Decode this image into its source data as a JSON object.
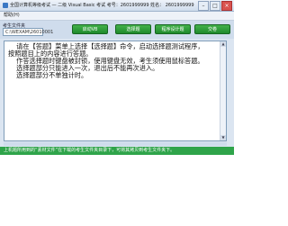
{
  "window": {
    "title": "全国计算机等级考试 — 二级 Visual Basic 考试   考号：2601999999   姓名：   2601999999"
  },
  "menu": {
    "items": [
      "帮助(H)"
    ]
  },
  "toolbar": {
    "path_label": "考生文件夹",
    "path_value": "C:\\WEXAM\\26010001",
    "buttons": [
      "启动VB",
      "选择题",
      "程序设计题",
      "交卷"
    ]
  },
  "content": {
    "lines": [
      "    请在【答题】菜单上选择【选择题】命令，启动选择题测试程序，",
      "按照题目上的内容进行答题。",
      "    作答选择题时键盘被封锁，使用键盘无效，考生须使用鼠标答题。",
      "    选择题部分只能进入一次，退出后不能再次进入。",
      "    选择题部分不单独计时。"
    ]
  },
  "statusbar": {
    "text": "上机题所用到的“素材文件”在下载的考生文件夹目录下，可将其拷贝到考生文件夹下。"
  },
  "colors": {
    "button_green": "#2fa44a",
    "frame": "#dbe5f1"
  }
}
